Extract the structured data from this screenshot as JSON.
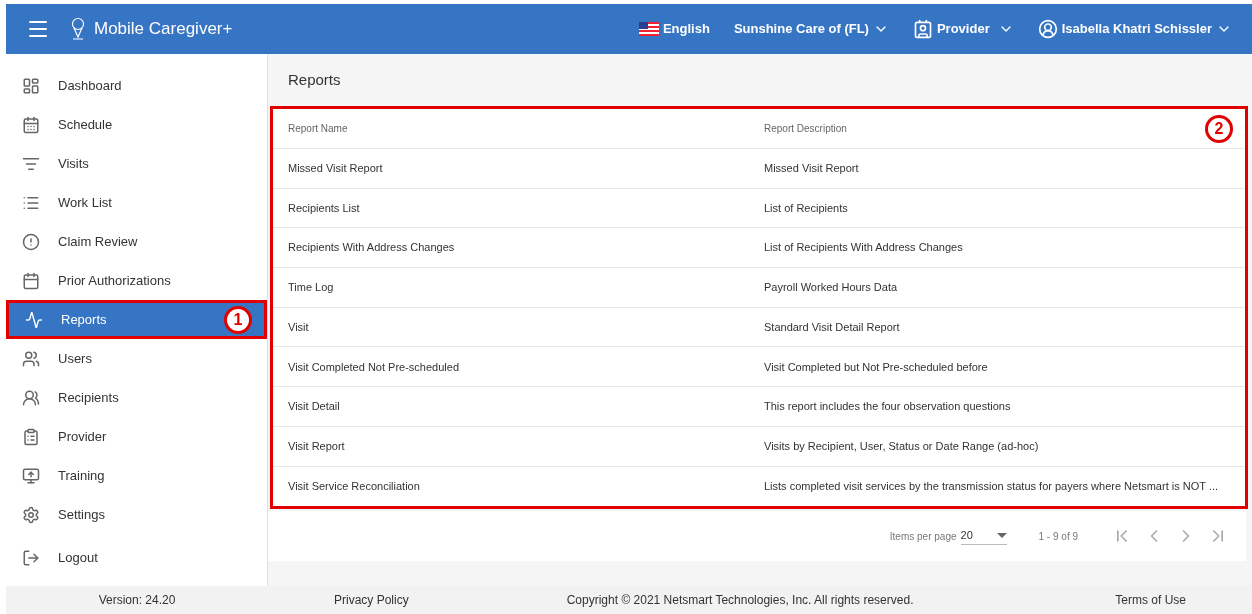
{
  "header": {
    "app_name": "Mobile Caregiver+",
    "language": "English",
    "agency": "Sunshine Care of (FL)",
    "role": "Provider",
    "user": "Isabella Khatri Schissler"
  },
  "sidebar": {
    "items": [
      {
        "label": "Dashboard",
        "selected": false
      },
      {
        "label": "Schedule",
        "selected": false
      },
      {
        "label": "Visits",
        "selected": false
      },
      {
        "label": "Work List",
        "selected": false
      },
      {
        "label": "Claim Review",
        "selected": false
      },
      {
        "label": "Prior Authorizations",
        "selected": false
      },
      {
        "label": "Reports",
        "selected": true,
        "callout": "1"
      },
      {
        "label": "Users",
        "selected": false
      },
      {
        "label": "Recipients",
        "selected": false
      },
      {
        "label": "Provider",
        "selected": false
      },
      {
        "label": "Training",
        "selected": false
      },
      {
        "label": "Settings",
        "selected": false
      },
      {
        "label": "Logout",
        "selected": false
      }
    ]
  },
  "page_title": "Reports",
  "table": {
    "callout": "2",
    "columns": [
      "Report Name",
      "Report Description"
    ],
    "rows": [
      [
        "Missed Visit Report",
        "Missed Visit Report"
      ],
      [
        "Recipients List",
        "List of Recipients"
      ],
      [
        "Recipients With Address Changes",
        "List of Recipients With Address Changes"
      ],
      [
        "Time Log",
        "Payroll Worked Hours Data"
      ],
      [
        "Visit",
        "Standard Visit Detail Report"
      ],
      [
        "Visit Completed Not Pre-scheduled",
        "Visit Completed but Not Pre-scheduled before"
      ],
      [
        "Visit Detail",
        "This report includes the four observation questions"
      ],
      [
        "Visit Report",
        "Visits by Recipient, User, Status or Date Range (ad-hoc)"
      ],
      [
        "Visit Service Reconciliation",
        "Lists completed visit services by the transmission status for payers where Netsmart is NOT ..."
      ]
    ]
  },
  "pagination": {
    "items_per_page_label": "Items per page",
    "items_per_page": "20",
    "range": "1 - 9 of 9"
  },
  "footer": {
    "version": "Version: 24.20",
    "privacy": "Privacy Policy",
    "copyright": "Copyright © 2021 Netsmart Technologies, Inc. All rights reserved.",
    "terms": "Terms of Use"
  }
}
